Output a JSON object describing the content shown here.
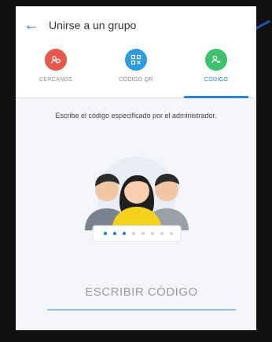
{
  "header": {
    "back_icon": "arrow-left-icon",
    "title": "Unirse a un grupo"
  },
  "tabs": [
    {
      "label": "CERCANOS",
      "icon": "nearby-people-icon",
      "color": "#e8584a",
      "active": false
    },
    {
      "label": "CÓDIGO QR",
      "icon": "qr-code-icon",
      "color": "#2c9be0",
      "active": false
    },
    {
      "label": "CÓDIGO",
      "icon": "code-group-icon",
      "color": "#3cc26a",
      "active": true
    }
  ],
  "main": {
    "instruction": "Escribe el código especificado por el administrador.",
    "code_placeholder": "ESCRIBIR CÓDIGO"
  },
  "colors": {
    "accent": "#2c84d8",
    "underline": "#8fc3ee"
  }
}
